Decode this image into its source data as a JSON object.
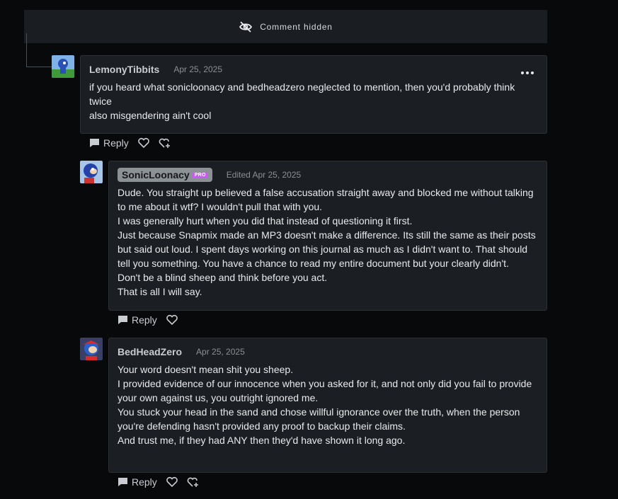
{
  "hidden_notice": {
    "label": "Comment hidden"
  },
  "comments": [
    {
      "username": "LemonyTibbits",
      "date": "Apr 25, 2025",
      "lines": [
        "if you heard what sonicloonacy and bedheadzero neglected to mention, then you'd probably think",
        "twice",
        "also misgendering ain't cool"
      ],
      "reply_label": "Reply"
    },
    {
      "username": "SonicLoonacy",
      "badge": "PRO",
      "date": "Edited Apr 25, 2025",
      "lines": [
        "Dude. You straight up believed a false accusation straight away and blocked me without talking",
        "to me about it wtf? I wouldn't pull that with you.",
        "I was generally hurt when you did that instead of questioning it first.",
        "Just because Snapmix made an MP3 doesn't make a difference. Its still the same as their posts",
        "but said out loud. I spent days working on this journal as much as I didn't want to. That should",
        "tell you something. You have a chance to read my entire document but your clearly didn't.",
        "Don't be a blind sheep and think before you act.",
        "That is all I will say."
      ],
      "reply_label": "Reply"
    },
    {
      "username": "BedHeadZero",
      "date": "Apr 25, 2025",
      "lines": [
        "Your word doesn't mean shit you sheep.",
        "I provided evidence of our innocence when you asked for it, and not only did you fail to provide",
        "your own against us, you outright ignored me.",
        "You stuck your head in the sand and chose willful ignorance over the truth, when the person",
        "you're defending hasn't provided any proof to backup their claims.",
        "And trust me, if they had ANY then they'd have shown it long ago."
      ],
      "reply_label": "Reply"
    }
  ],
  "colors": {
    "background": "#07090b",
    "card": "#1b1e22",
    "pro_badge": "#c75cf0"
  }
}
